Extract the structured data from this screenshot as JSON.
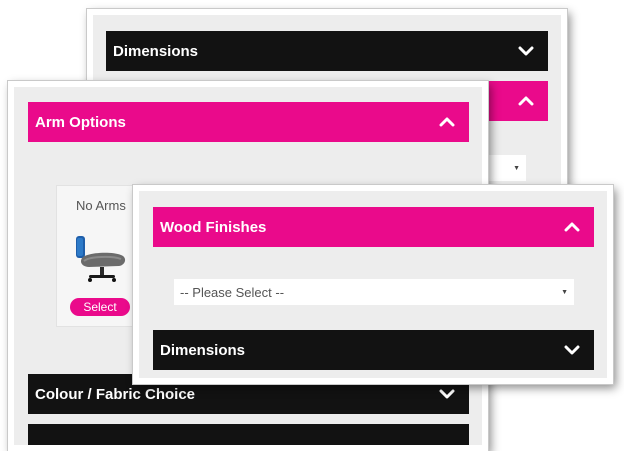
{
  "back_panel": {
    "dimensions_label": "Dimensions"
  },
  "arm_panel": {
    "header_label": "Arm Options",
    "option_card": {
      "title": "No Arms",
      "select_label": "Select"
    },
    "colour_label": "Colour / Fabric Choice"
  },
  "wood_panel": {
    "header_label": "Wood Finishes",
    "select_placeholder": "-- Please Select --",
    "dimensions_label": "Dimensions"
  },
  "icons": {
    "expand": "chevron-down-icon",
    "collapse": "chevron-up-icon"
  },
  "colors": {
    "accent": "#ea0a8b",
    "dark_bar": "#121212",
    "panel_bg": "#ededed"
  }
}
